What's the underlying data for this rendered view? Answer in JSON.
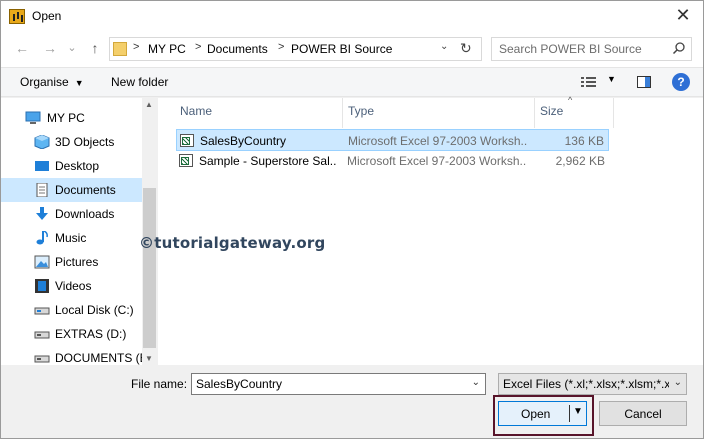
{
  "window": {
    "title": "Open",
    "close_glyph": "✕"
  },
  "nav_buttons": {
    "back": "←",
    "forward": "→",
    "history": "⌄",
    "up": "↑"
  },
  "address": {
    "crumbs": [
      "MY PC",
      "Documents",
      "POWER BI Source"
    ],
    "separator": ">",
    "dropdown_glyph": "⌄",
    "refresh_glyph": "↻"
  },
  "search": {
    "placeholder": "Search POWER BI Source",
    "icon": "search-icon"
  },
  "commandbar": {
    "organise": "Organise",
    "new_folder": "New folder",
    "dropdown_glyph": "▼",
    "help_glyph": "?"
  },
  "sidebar": {
    "items": [
      {
        "label": "MY PC",
        "icon": "computer-icon"
      },
      {
        "label": "3D Objects",
        "icon": "cube-icon"
      },
      {
        "label": "Desktop",
        "icon": "desktop-icon"
      },
      {
        "label": "Documents",
        "icon": "documents-icon",
        "selected": true
      },
      {
        "label": "Downloads",
        "icon": "download-arrow-icon"
      },
      {
        "label": "Music",
        "icon": "music-note-icon"
      },
      {
        "label": "Pictures",
        "icon": "pictures-icon"
      },
      {
        "label": "Videos",
        "icon": "film-icon"
      },
      {
        "label": "Local Disk (C:)",
        "icon": "drive-icon"
      },
      {
        "label": "EXTRAS (D:)",
        "icon": "drive-icon"
      },
      {
        "label": "DOCUMENTS (E",
        "icon": "drive-icon"
      }
    ],
    "scroll_up_glyph": "▲",
    "scroll_down_glyph": "▼"
  },
  "filelist": {
    "columns": {
      "name": "Name",
      "type": "Type",
      "size": "Size"
    },
    "sort_glyph": "^",
    "rows": [
      {
        "name": "SalesByCountry",
        "type": "Microsoft Excel 97-2003 Worksh...",
        "size": "136 KB",
        "selected": true
      },
      {
        "name": "Sample - Superstore Sal...",
        "type": "Microsoft Excel 97-2003 Worksh...",
        "size": "2,962 KB",
        "selected": false
      }
    ]
  },
  "watermark": "©tutorialgateway.org",
  "footer": {
    "filename_label": "File name:",
    "filename_value": "SalesByCountry",
    "filter_value": "Excel Files (*.xl;*.xlsx;*.xlsm;*.xls",
    "open_label": "Open",
    "cancel_label": "Cancel",
    "arrow_glyph": "⌄",
    "split_glyph": "▼"
  },
  "colors": {
    "selection": "#cce8ff",
    "accent": "#0078d7",
    "highlight_box": "#58142a"
  }
}
